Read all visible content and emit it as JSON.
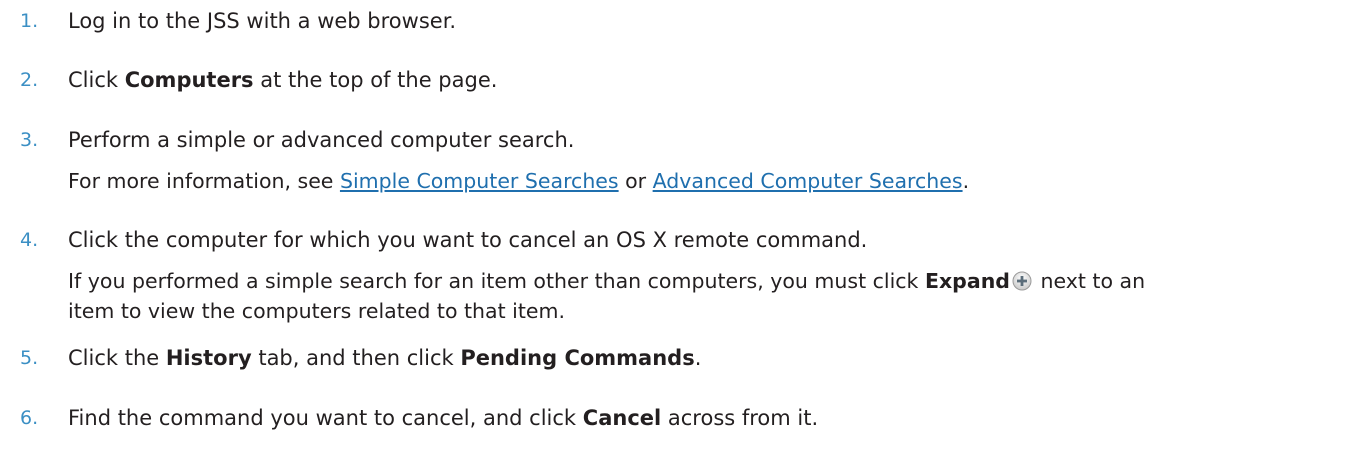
{
  "steps": [
    {
      "number": "1.",
      "text": "Log in to the JSS with a web browser."
    },
    {
      "number": "2.",
      "pre": "Click ",
      "bold": "Computers",
      "post": " at the top of the page."
    },
    {
      "number": "3.",
      "text": "Perform a simple or advanced computer search.",
      "sub_pre": "For more information, see ",
      "link1": "Simple Computer Searches",
      "sub_mid": " or ",
      "link2": "Advanced Computer Searches",
      "sub_post": "."
    },
    {
      "number": "4.",
      "text": "Click the computer for which you want to cancel an OS X remote command.",
      "sub_pre": "If you performed a simple search for an item other than computers, you must click ",
      "bold": "Expand",
      "sub_post_line1": " next to an",
      "sub_line2": "item to view the computers related to that item."
    },
    {
      "number": "5.",
      "pre": "Click the ",
      "bold1": "History",
      "mid": " tab, and then click ",
      "bold2": "Pending Commands",
      "post": "."
    },
    {
      "number": "6.",
      "pre": "Find the command you want to cancel, and click ",
      "bold": "Cancel",
      "post": " across from it."
    }
  ],
  "icons": {
    "expand": "plus-circle-icon"
  },
  "colors": {
    "number": "#3b8fc4",
    "link": "#1f6fae",
    "text": "#231f20"
  }
}
